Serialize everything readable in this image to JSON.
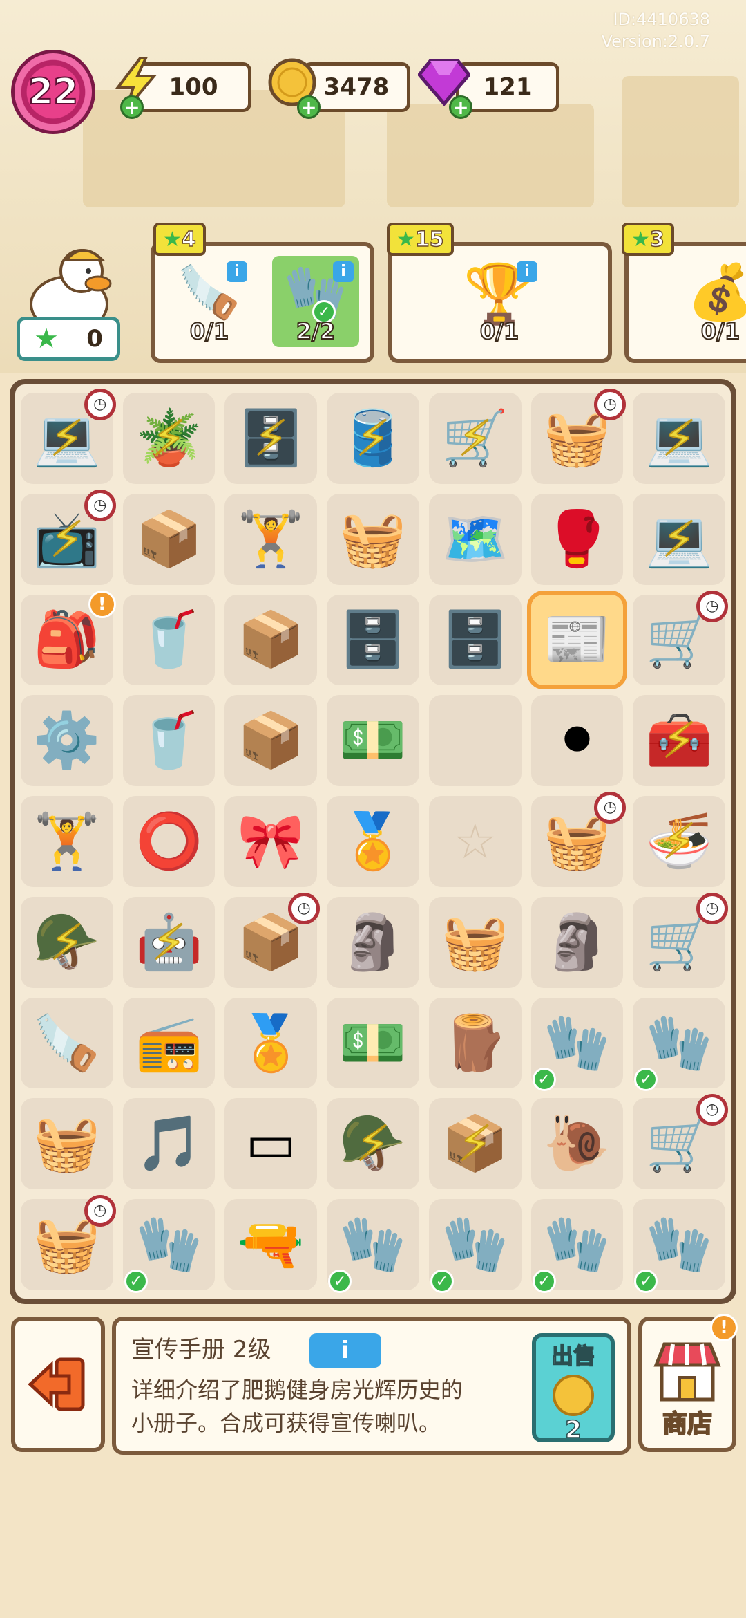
{
  "meta": {
    "id": "ID:4410638",
    "version": "Version:2.0.7"
  },
  "player": {
    "level": "22"
  },
  "resources": {
    "energy": {
      "value": "100",
      "icon": "lightning-icon"
    },
    "coins": {
      "value": "3478",
      "icon": "coin-icon"
    },
    "gems": {
      "value": "121",
      "icon": "gem-icon"
    }
  },
  "star_counter": {
    "value": "0"
  },
  "orders": [
    {
      "reward": "4",
      "items": [
        {
          "icon": "electric-saw-icon",
          "progress": "0/1",
          "complete": false
        },
        {
          "icon": "work-gloves-icon",
          "progress": "2/2",
          "complete": true
        }
      ]
    },
    {
      "reward": "15",
      "items": [
        {
          "icon": "trophy-icon",
          "progress": "0/1",
          "complete": false
        }
      ]
    },
    {
      "reward": "3",
      "items": [
        {
          "icon": "sack-icon",
          "progress": "0/1",
          "complete": false
        }
      ]
    }
  ],
  "board": {
    "cells": [
      {
        "glyph": "💻",
        "icon": "laptop-icon",
        "bolt": true,
        "clock": true
      },
      {
        "glyph": "🪴",
        "icon": "plant-pot-icon",
        "bolt": true
      },
      {
        "glyph": "🗄️",
        "icon": "locker-icon",
        "bolt": true
      },
      {
        "glyph": "🛢️",
        "icon": "water-tank-icon",
        "bolt": true
      },
      {
        "glyph": "🛒",
        "icon": "wheelbarrow-icon",
        "bolt": true
      },
      {
        "glyph": "🧺",
        "icon": "shopping-basket-icon",
        "clock": true
      },
      {
        "glyph": "💻",
        "icon": "green-laptop-icon",
        "bolt": true
      },
      {
        "glyph": "📺",
        "icon": "retro-tv-icon",
        "bolt": true,
        "clock": true
      },
      {
        "glyph": "📦",
        "icon": "sandbags-icon"
      },
      {
        "glyph": "🏋️",
        "icon": "bench-press-icon"
      },
      {
        "glyph": "🧺",
        "icon": "dumbbell-basket-icon"
      },
      {
        "glyph": "🗺️",
        "icon": "fitness-map-icon"
      },
      {
        "glyph": "🥊",
        "icon": "boxing-glove-icon"
      },
      {
        "glyph": "💻",
        "icon": "green-console-icon",
        "bolt": true
      },
      {
        "glyph": "🎒",
        "icon": "pink-backpack-icon",
        "alert": true
      },
      {
        "glyph": "🥤",
        "icon": "blue-cup-icon"
      },
      {
        "glyph": "📦",
        "icon": "cardboard-box-icon"
      },
      {
        "glyph": "🗄️",
        "icon": "small-drawer-icon"
      },
      {
        "glyph": "🗄️",
        "icon": "drawer-cabinet-icon"
      },
      {
        "glyph": "📰",
        "icon": "brochure-icon",
        "selected": true
      },
      {
        "glyph": "🛒",
        "icon": "cart-icon",
        "clock": true
      },
      {
        "glyph": "⚙️",
        "icon": "ab-roller-icon"
      },
      {
        "glyph": "🥤",
        "icon": "twin-cups-icon"
      },
      {
        "glyph": "📦",
        "icon": "open-box-icon"
      },
      {
        "glyph": "💵",
        "icon": "cash-icon"
      },
      {
        "glyph": "",
        "icon": "empty-cell"
      },
      {
        "glyph": "⚫",
        "icon": "weight-plate-icon"
      },
      {
        "glyph": "🧰",
        "icon": "tool-chest-icon",
        "bolt": true
      },
      {
        "glyph": "🏋️",
        "icon": "dumbbell-pair-icon"
      },
      {
        "glyph": "⭕",
        "icon": "hula-hoop-icon"
      },
      {
        "glyph": "🎀",
        "icon": "ribbon-icon"
      },
      {
        "glyph": "🏅",
        "icon": "rosette-medal-icon"
      },
      {
        "glyph": "☆",
        "icon": "star-placeholder-icon",
        "empty_star": true
      },
      {
        "glyph": "🧺",
        "icon": "basket-icon",
        "clock": true
      },
      {
        "glyph": "🍜",
        "icon": "food-box-icon",
        "bolt": true
      },
      {
        "glyph": "🪖",
        "icon": "hard-hat-goose-icon",
        "bolt": true
      },
      {
        "glyph": "🤖",
        "icon": "robot-vacuum-icon",
        "bolt": true
      },
      {
        "glyph": "📦",
        "icon": "towel-box-icon",
        "clock": true
      },
      {
        "glyph": "🗿",
        "icon": "statue-bust-icon"
      },
      {
        "glyph": "🧺",
        "icon": "pink-planter-icon"
      },
      {
        "glyph": "🗿",
        "icon": "goose-statue-icon"
      },
      {
        "glyph": "🛒",
        "icon": "dumbbell-cart-icon",
        "clock": true
      },
      {
        "glyph": "🪚",
        "icon": "hand-saw-icon"
      },
      {
        "glyph": "📻",
        "icon": "music-player-icon"
      },
      {
        "glyph": "🏅",
        "icon": "gold-medal-icon"
      },
      {
        "glyph": "💵",
        "icon": "cash-stack-icon"
      },
      {
        "glyph": "🪵",
        "icon": "wood-stump-icon"
      },
      {
        "glyph": "🧤",
        "icon": "work-gloves-icon",
        "check": true
      },
      {
        "glyph": "🧤",
        "icon": "work-gloves-icon",
        "check": true
      },
      {
        "glyph": "🧺",
        "icon": "purple-basket-icon"
      },
      {
        "glyph": "🎵",
        "icon": "headphone-icon"
      },
      {
        "glyph": "▭",
        "icon": "frame-icon"
      },
      {
        "glyph": "🪖",
        "icon": "hard-hat-icon",
        "bolt": true
      },
      {
        "glyph": "📦",
        "icon": "taped-box-icon",
        "bolt": true
      },
      {
        "glyph": "🐌",
        "icon": "snail-icon"
      },
      {
        "glyph": "🛒",
        "icon": "yellow-cart-icon",
        "clock": true
      },
      {
        "glyph": "🧺",
        "icon": "flower-basket-icon",
        "clock": true
      },
      {
        "glyph": "🧤",
        "icon": "work-gloves-icon",
        "check": true
      },
      {
        "glyph": "🔫",
        "icon": "power-drill-icon"
      },
      {
        "glyph": "🧤",
        "icon": "work-gloves-icon",
        "check": true
      },
      {
        "glyph": "🧤",
        "icon": "work-gloves-icon",
        "check": true
      },
      {
        "glyph": "🧤",
        "icon": "work-gloves-icon",
        "check": true
      },
      {
        "glyph": "🧤",
        "icon": "work-gloves-icon",
        "check": true
      }
    ]
  },
  "selected_item": {
    "title": "宣传手册 2级",
    "info_label": "i",
    "description_line1": "详细介绍了肥鹅健身房光辉历史的",
    "description_line2": "小册子。合成可获得宣传喇叭。",
    "sell_label": "出售",
    "sell_price": "2"
  },
  "shop": {
    "label": "商店"
  },
  "colors": {
    "accent": "#6a4e37",
    "energy": "#f7e13a",
    "gem": "#c23ad6",
    "sell": "#5bd1d3"
  }
}
